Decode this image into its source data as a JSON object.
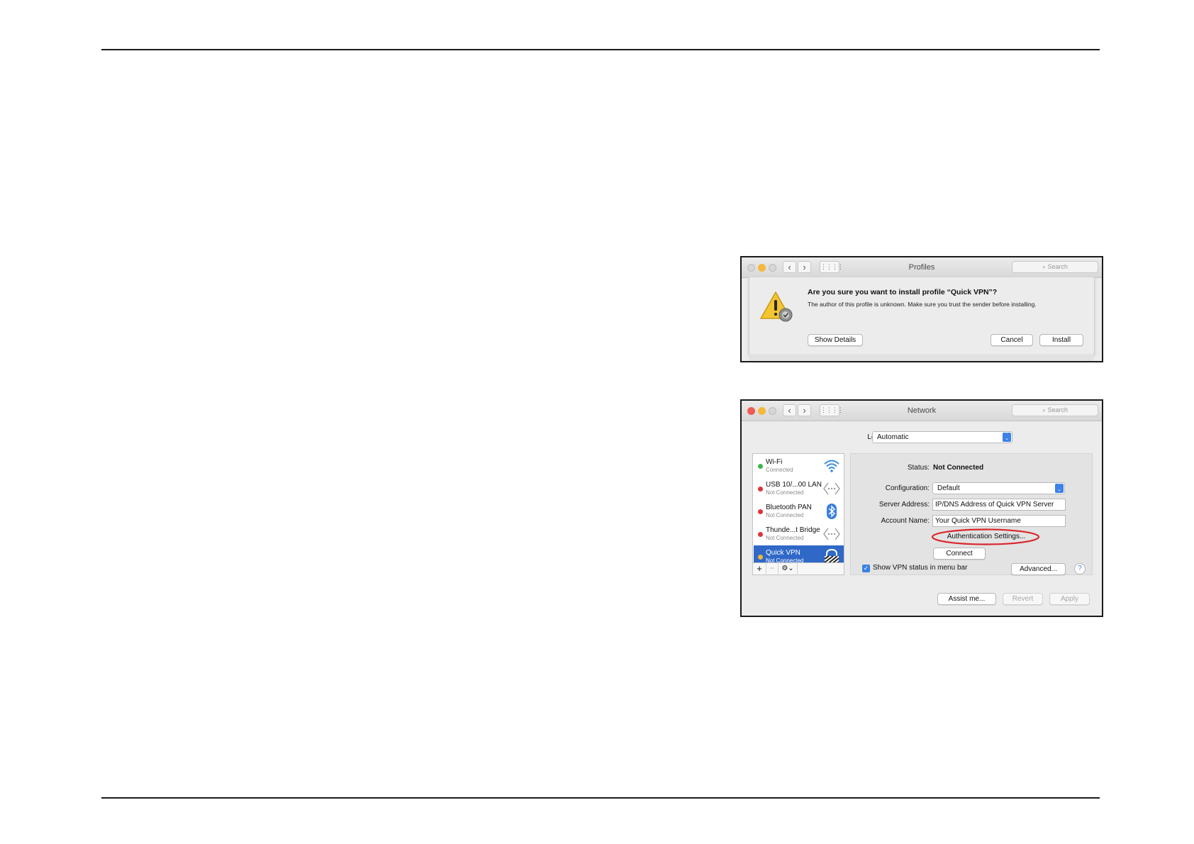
{
  "profiles_window": {
    "title": "Profiles",
    "search_placeholder": "Search",
    "dialog": {
      "heading": "Are you sure you want to install profile “Quick VPN”?",
      "message": "The author of this profile is unknown. Make sure you trust the sender before installing.",
      "show_details": "Show Details",
      "cancel": "Cancel",
      "install": "Install"
    }
  },
  "network_window": {
    "title": "Network",
    "search_placeholder": "Search",
    "location_label": "Location:",
    "location_value": "Automatic",
    "services": [
      {
        "name": "Wi-Fi",
        "status": "Connected",
        "dot": "#3cb84a"
      },
      {
        "name": "USB 10/...00 LAN",
        "status": "Not Connected",
        "dot": "#e2333a"
      },
      {
        "name": "Bluetooth PAN",
        "status": "Not Connected",
        "dot": "#e2333a"
      },
      {
        "name": "Thunde...t Bridge",
        "status": "Not Connected",
        "dot": "#e2333a"
      },
      {
        "name": "Quick VPN",
        "status": "Not Connected",
        "dot": "#f2b53a"
      }
    ],
    "list_controls": {
      "add": "+",
      "remove": "−",
      "gear": "⚙⌄"
    },
    "status_label": "Status:",
    "status_value": "Not Connected",
    "configuration_label": "Configuration:",
    "configuration_value": "Default",
    "server_label": "Server Address:",
    "server_value": "IP/DNS Address of Quick VPN Server",
    "account_label": "Account Name:",
    "account_value": "Your Quick VPN Username",
    "auth_button": "Authentication Settings...",
    "connect_button": "Connect",
    "show_vpn_status": "Show VPN status in menu bar",
    "advanced_button": "Advanced...",
    "help": "?",
    "assist_button": "Assist me...",
    "revert_button": "Revert",
    "apply_button": "Apply"
  },
  "colors": {
    "close": "#ee5b55",
    "minimize": "#f5b93a",
    "maximize": "#c8c8c8",
    "selection": "#2f68c7",
    "highlight_ellipse": "#d9262b"
  }
}
